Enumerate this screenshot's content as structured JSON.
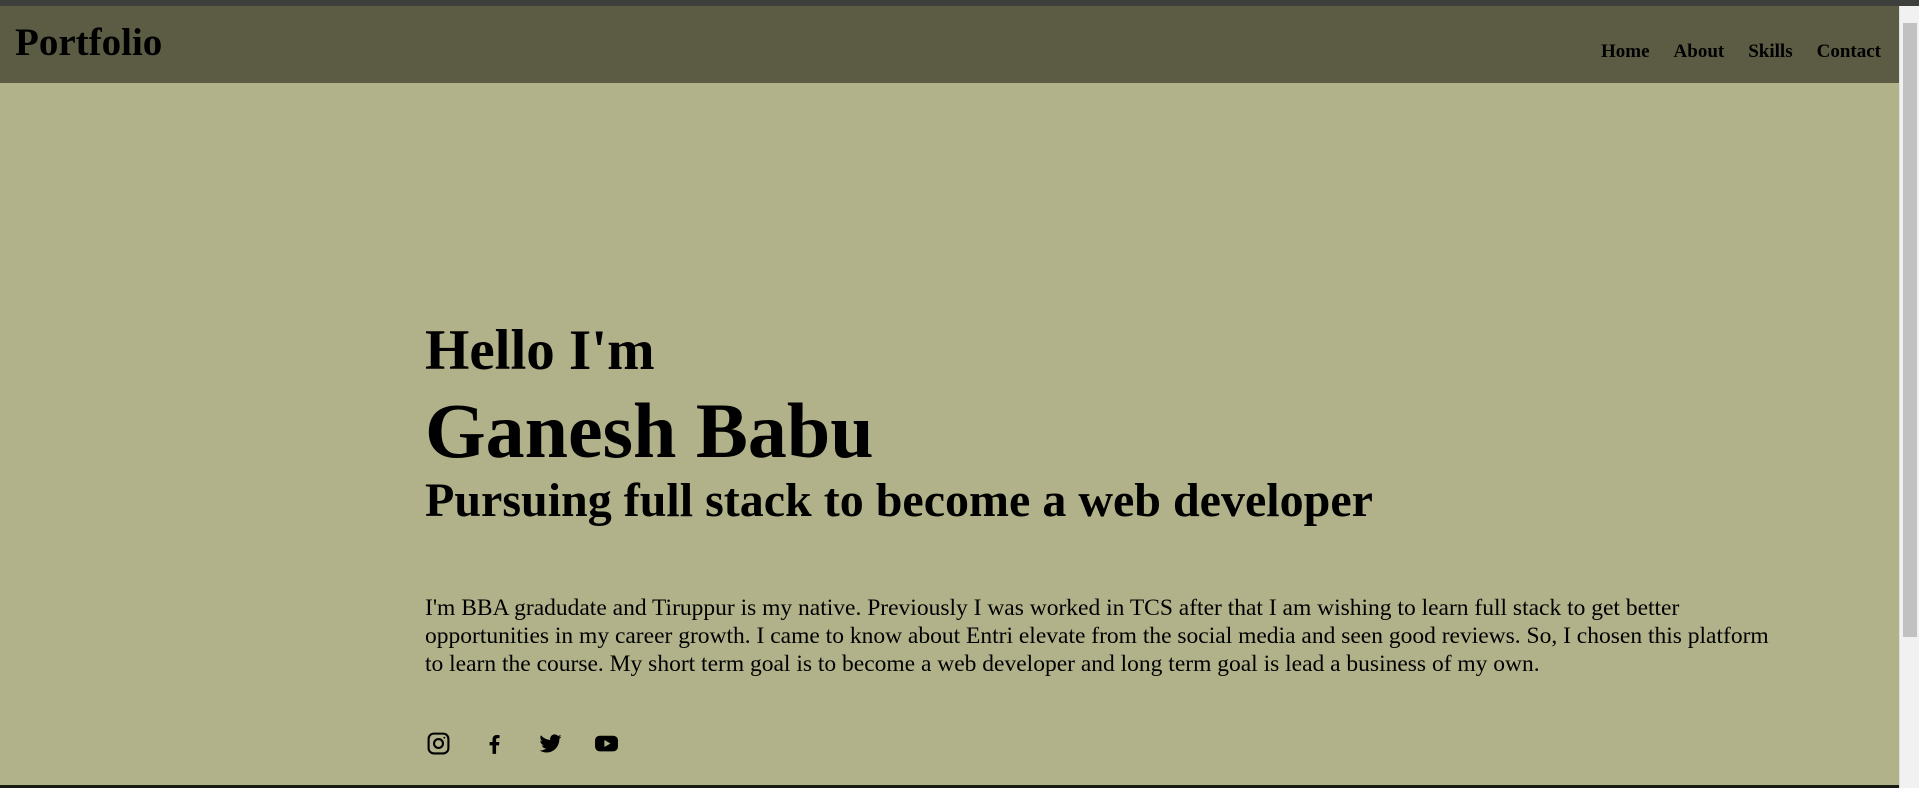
{
  "navbar": {
    "brand": "Portfolio",
    "links": [
      "Home",
      "About",
      "Skills",
      "Contact"
    ]
  },
  "hero": {
    "greeting": "Hello I'm",
    "name": "Ganesh Babu",
    "tagline": "Pursuing full stack to become a web developer",
    "bio": "I'm BBA gradudate and Tiruppur is my native. Previously I was worked in TCS after that I am wishing to learn full stack to get better opportunities in my career growth. I came to know about Entri elevate from the social media and seen good reviews. So, I chosen this platform to learn the course. My short term goal is to become a web developer and long term goal is lead a business of my own."
  },
  "social_icons": [
    "instagram-icon",
    "facebook-icon",
    "twitter-icon",
    "youtube-icon"
  ],
  "colors": {
    "background": "#b1b28a",
    "navbar": "#5c5c45",
    "text": "#000000"
  }
}
